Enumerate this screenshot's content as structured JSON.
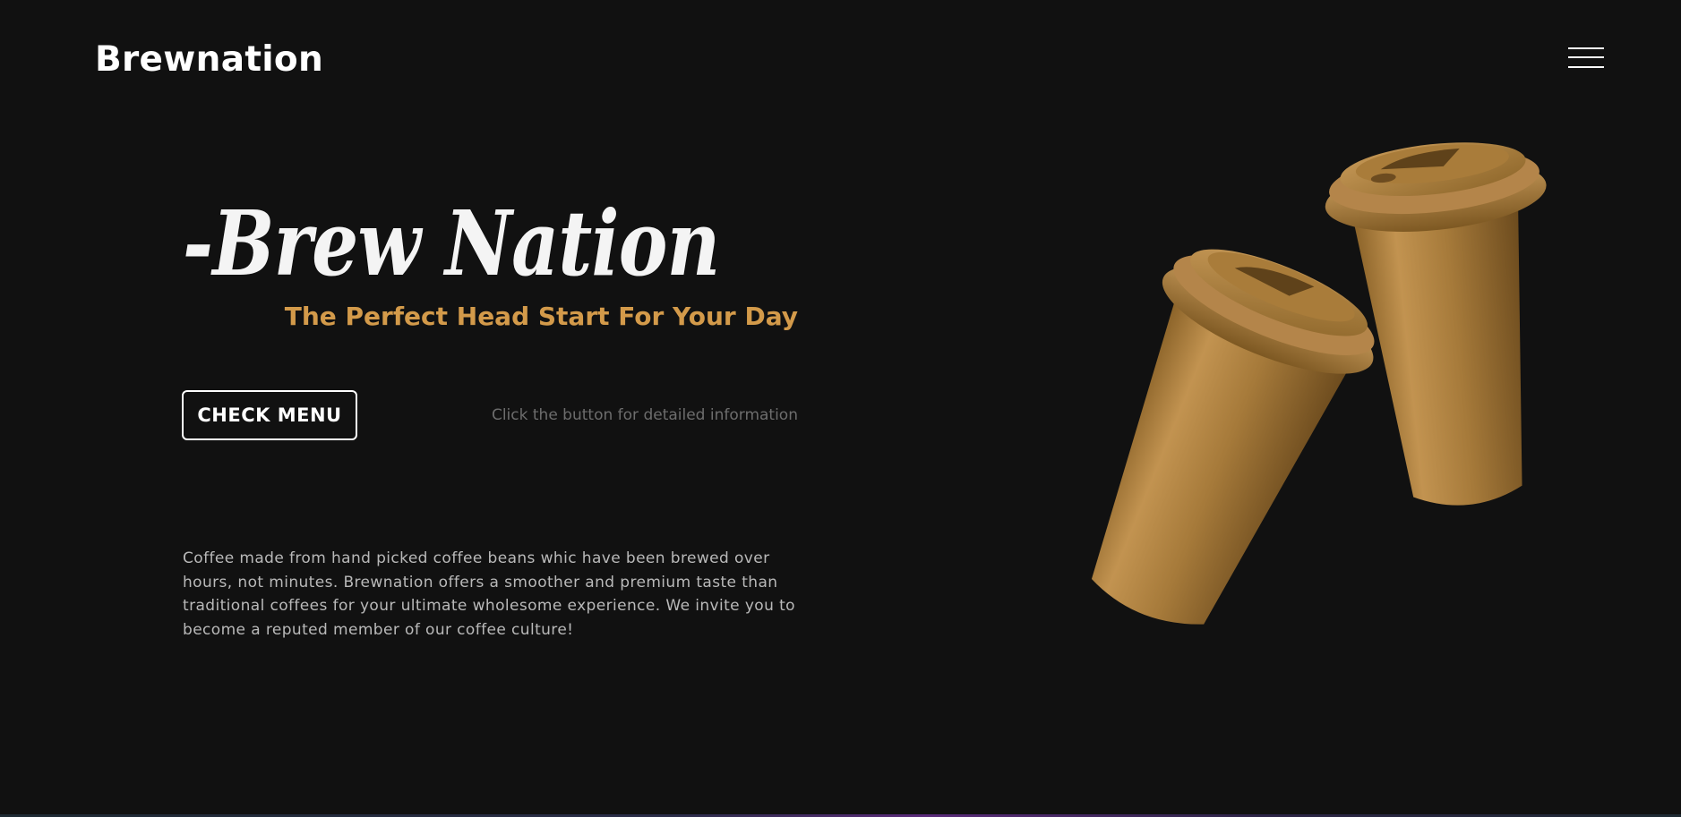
{
  "header": {
    "logo_text": "Brewnation",
    "menu_icon": "hamburger-menu-icon"
  },
  "hero": {
    "title": "-Brew Nation",
    "subtitle": "The Perfect Head Start For Your Day",
    "cta_label": "CHECK MENU",
    "cta_hint": "Click the button for detailed information",
    "description": "Coffee made from hand picked coffee beans whic have been brewed over hours, not minutes. Brewnation offers a smoother and premium taste than traditional coffees for your ultimate wholesome experience. We invite you to become a reputed member of our coffee culture!"
  },
  "image": {
    "subject": "two-coffee-cups"
  },
  "colors": {
    "background": "#111111",
    "accent": "#d39a4a",
    "text_primary": "#ffffff",
    "text_muted": "#b9b9b9",
    "hint": "#6d6d6d",
    "cup_gold": "#a97c3a"
  }
}
